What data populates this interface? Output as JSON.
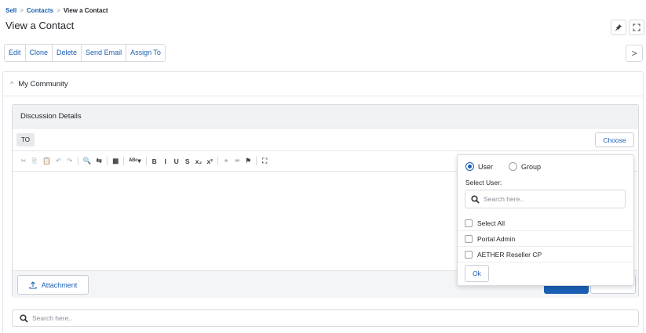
{
  "breadcrumb": {
    "root": "Sell",
    "parent": "Contacts",
    "current": "View a Contact",
    "separator": ">"
  },
  "page": {
    "title": "View a Contact"
  },
  "header_icons": {
    "pin": "pin-icon",
    "expand": "expand-icon"
  },
  "actions": [
    "Edit",
    "Clone",
    "Delete",
    "Send Email",
    "Assign To"
  ],
  "nav": {
    "next_icon": "chevron-right-icon",
    "next_glyph": ">"
  },
  "community": {
    "title": "My Community",
    "collapse_glyph": "^"
  },
  "discussion": {
    "title": "Discussion Details",
    "to_label": "TO",
    "choose_label": "Choose",
    "attachment_label": "Attachment"
  },
  "editor_toolbar": [
    {
      "name": "cut-icon",
      "glyph": "✂",
      "enabled": false
    },
    {
      "name": "copy-icon",
      "glyph": "⎘",
      "enabled": false
    },
    {
      "name": "paste-icon",
      "glyph": "📋",
      "enabled": false
    },
    {
      "name": "undo-icon",
      "glyph": "↶",
      "enabled": false
    },
    {
      "name": "redo-icon",
      "glyph": "↷",
      "enabled": false
    },
    {
      "sep": true
    },
    {
      "name": "find-icon",
      "glyph": "🔍",
      "enabled": true
    },
    {
      "name": "replace-icon",
      "glyph": "⇆",
      "enabled": true
    },
    {
      "sep": true
    },
    {
      "name": "select-all-icon",
      "glyph": "▦",
      "enabled": true
    },
    {
      "sep": true
    },
    {
      "name": "spellcheck-icon",
      "glyph": "ᴬᴮᶜ▾",
      "enabled": true
    },
    {
      "sep": true
    },
    {
      "name": "bold-icon",
      "glyph": "B",
      "enabled": true
    },
    {
      "name": "italic-icon",
      "glyph": "I",
      "enabled": true
    },
    {
      "name": "underline-icon",
      "glyph": "U",
      "enabled": true
    },
    {
      "name": "strike-icon",
      "glyph": "S",
      "enabled": true
    },
    {
      "name": "subscript-icon",
      "glyph": "x₂",
      "enabled": true
    },
    {
      "name": "superscript-icon",
      "glyph": "x²",
      "enabled": true
    },
    {
      "sep": true
    },
    {
      "name": "link-icon",
      "glyph": "⚭",
      "enabled": false
    },
    {
      "name": "unlink-icon",
      "glyph": "⚮",
      "enabled": false
    },
    {
      "name": "flag-icon",
      "glyph": "⚑",
      "enabled": true
    },
    {
      "sep": true
    },
    {
      "name": "maximize-icon",
      "glyph": "⛶",
      "enabled": true
    }
  ],
  "search": {
    "placeholder": "Search here.."
  },
  "popover": {
    "options": [
      {
        "label": "User",
        "checked": true
      },
      {
        "label": "Group",
        "checked": false
      }
    ],
    "select_label": "Select User:",
    "search_placeholder": "Search here..",
    "users": [
      "Select All",
      "Portal Admin",
      "AETHER Reseller CP"
    ],
    "ok_label": "Ok"
  },
  "colors": {
    "accent": "#1a5fb4",
    "border": "#d6d9de",
    "header_bg": "#f1f2f4"
  }
}
